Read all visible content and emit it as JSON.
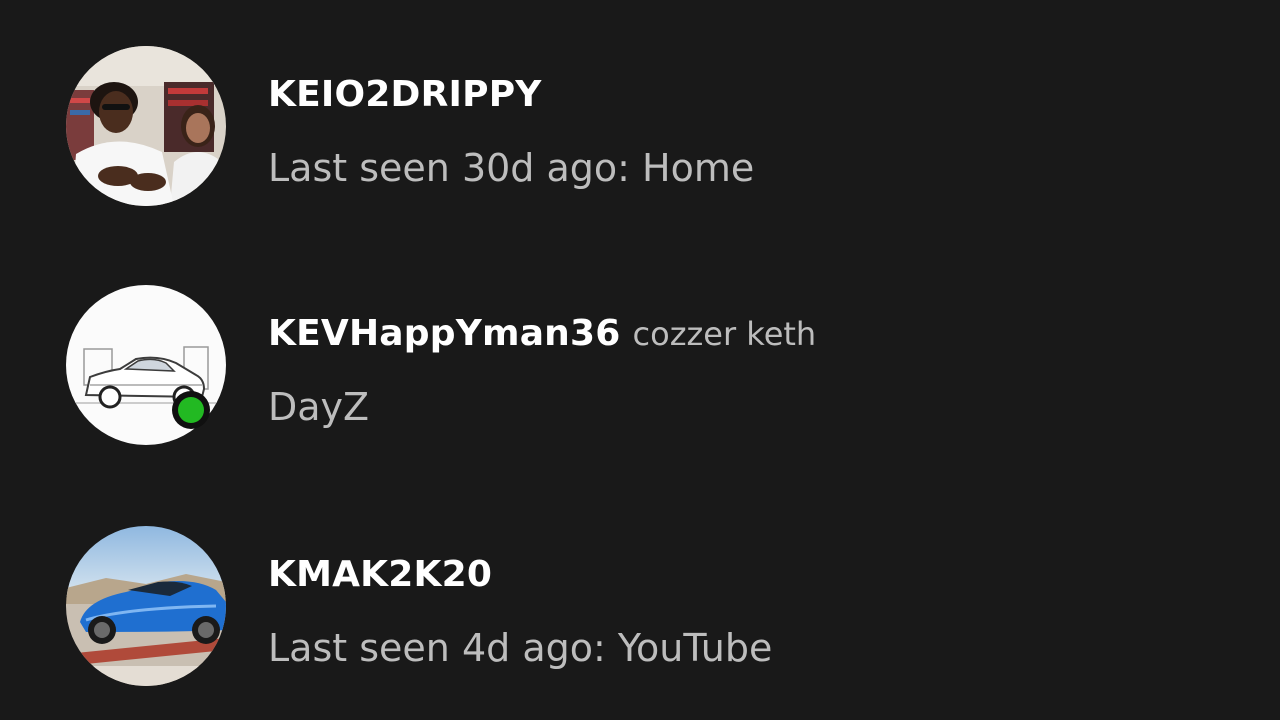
{
  "friends": [
    {
      "gamertag": "KEIO2DRIPPY",
      "real_name": "",
      "status": "Last seen 30d ago: Home",
      "online": false,
      "avatar_icon": "avatar-photo-two-people"
    },
    {
      "gamertag": "KEVHappYman36",
      "real_name": "cozzer keth",
      "status": "DayZ",
      "online": true,
      "avatar_icon": "avatar-sketch-white-car"
    },
    {
      "gamertag": "KMAK2K20",
      "real_name": "",
      "status": "Last seen 4d ago: YouTube",
      "online": false,
      "avatar_icon": "avatar-blue-sports-car"
    }
  ],
  "colors": {
    "background": "#191919",
    "online_indicator": "#22b922",
    "gamertag_text": "#ffffff",
    "status_text": "#bdbdbd"
  }
}
